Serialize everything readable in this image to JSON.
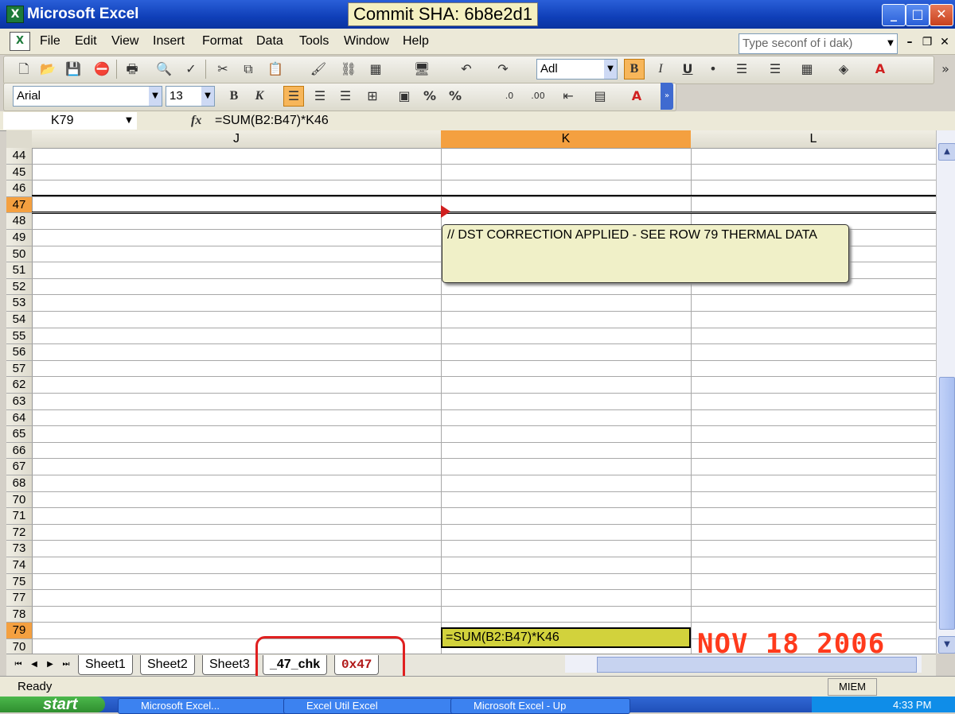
{
  "window": {
    "title": "Microsoft Excel",
    "commit_label": "Commit SHA: 6b8e2d1"
  },
  "menu": {
    "items": [
      "File",
      "Edit",
      "View",
      "Insert",
      "Format",
      "Data",
      "Tools",
      "Window",
      "Help"
    ],
    "help_placeholder": "Type seconf of i dak)"
  },
  "toolbar": {
    "font_style_combo": "Adl",
    "font_name": "Arial",
    "font_size": "13"
  },
  "formula_bar": {
    "name_box": "K79",
    "fx": "fx",
    "formula": "=SUM(B2:B47)*K46"
  },
  "grid": {
    "columns": [
      {
        "label": "J",
        "selected": false
      },
      {
        "label": "K",
        "selected": true
      },
      {
        "label": "L",
        "selected": false
      }
    ],
    "rows": [
      "44",
      "45",
      "46",
      "47",
      "48",
      "49",
      "50",
      "51",
      "52",
      "53",
      "54",
      "55",
      "56",
      "57",
      "62",
      "63",
      "64",
      "65",
      "66",
      "67",
      "68",
      "70",
      "71",
      "72",
      "73",
      "74",
      "75",
      "77",
      "78",
      "79",
      "70"
    ],
    "selected_rows": [
      "47",
      "79"
    ],
    "comment": "// DST CORRECTION APPLIED - SEE ROW 79 THERMAL DATA",
    "active_cell_content": "=SUM(B2:B47)*K46"
  },
  "sheet_tabs": [
    {
      "label": "Sheet1",
      "active": false
    },
    {
      "label": "Sheet2",
      "active": false
    },
    {
      "label": "Sheet3",
      "active": false
    },
    {
      "label": "_47_chk",
      "active": true
    },
    {
      "label": "0x47",
      "active": false
    }
  ],
  "date_stamp": "NOV 18 2006",
  "status": {
    "text": "Ready",
    "mode": "MIEM"
  },
  "taskbar": {
    "start": "start",
    "tasks": [
      "Microsoft Excel...",
      "Excel Util Excel",
      "Microsoft Excel - Up"
    ],
    "clock": "4:33 PM"
  },
  "colors": {
    "selection_header": "#f4a040",
    "active_cell": "#d2d23c",
    "annotation": "#e02020",
    "date_stamp": "#ff3a1c"
  }
}
